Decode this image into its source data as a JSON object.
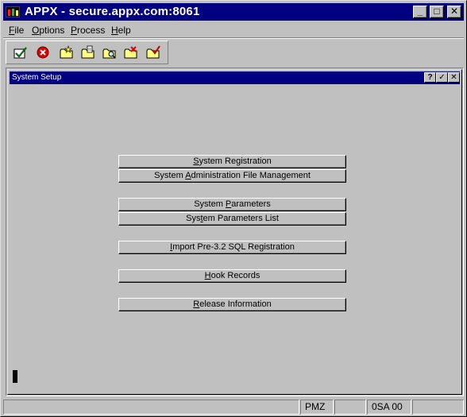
{
  "window": {
    "title": "APPX - secure.appx.com:8061",
    "minimize": "_",
    "maximize": "□",
    "close": "✕"
  },
  "menubar": {
    "items": [
      {
        "pre": "",
        "ul": "F",
        "post": "ile"
      },
      {
        "pre": "",
        "ul": "O",
        "post": "ptions"
      },
      {
        "pre": "",
        "ul": "P",
        "post": "rocess"
      },
      {
        "pre": "",
        "ul": "H",
        "post": "elp"
      }
    ]
  },
  "toolbar": {
    "icons": [
      "ok-check-icon",
      "cancel-icon",
      "folder-star-icon",
      "folder-edit-icon",
      "folder-search-icon",
      "folder-delete-icon",
      "folder-check-icon"
    ]
  },
  "child": {
    "title": "System Setup",
    "help": "?",
    "ok": "✓",
    "close": "✕"
  },
  "menu_buttons": [
    {
      "pre": "",
      "ul": "S",
      "post": "ystem Registration"
    },
    {
      "pre": "System ",
      "ul": "A",
      "post": "dministration File Management"
    },
    {
      "pre": "System ",
      "ul": "P",
      "post": "arameters"
    },
    {
      "pre": "Sys",
      "ul": "t",
      "post": "em Parameters List"
    },
    {
      "pre": "",
      "ul": "I",
      "post": "mport Pre-3.2 SQL Registration"
    },
    {
      "pre": "",
      "ul": "H",
      "post": "ook Records"
    },
    {
      "pre": "",
      "ul": "R",
      "post": "elease Information"
    }
  ],
  "statusbar": {
    "cells": [
      "",
      "PMZ",
      "",
      "0SA 00",
      ""
    ]
  },
  "colors": {
    "titlebar": "#000080",
    "face": "#c0c0c0"
  }
}
